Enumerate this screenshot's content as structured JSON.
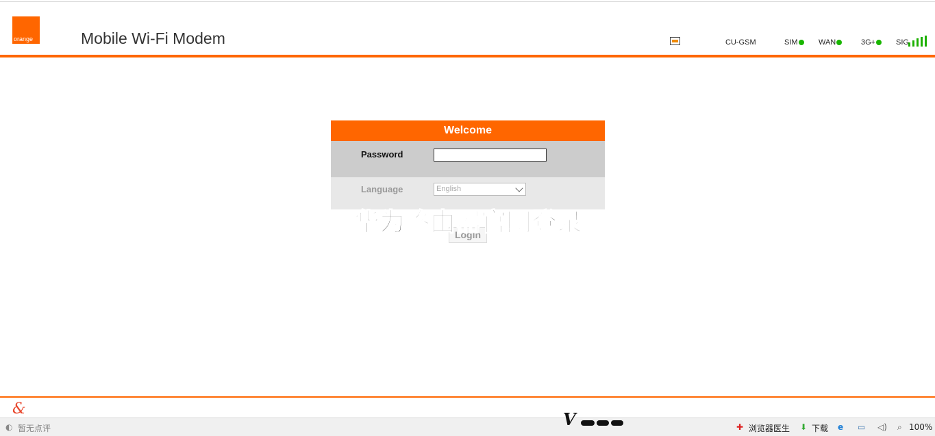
{
  "header": {
    "logo_text": "orange",
    "title": "Mobile Wi-Fi Modem",
    "network": "CU-GSM",
    "indicators": [
      "SIM",
      "WAN",
      "3G+",
      "SIG"
    ]
  },
  "login": {
    "panel_title": "Welcome",
    "password_label": "Password",
    "password_value": "",
    "language_label": "Language",
    "language_value": "English",
    "login_button": "Login"
  },
  "overlay": {
    "watermark": "华为路由器官网登录"
  },
  "statusbar": {
    "comments": "暂无点评",
    "doctor": "浏览器医生",
    "download": "下载",
    "zoom": "100%",
    "brand_letter": "V"
  },
  "colors": {
    "brand_orange": "#ff6600",
    "status_green": "#18b500"
  }
}
